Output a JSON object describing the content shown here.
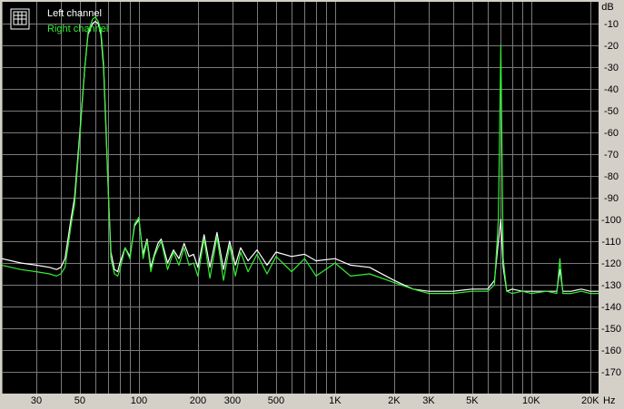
{
  "chart_data": {
    "type": "line",
    "xscale": "log",
    "xlim": [
      20,
      22050
    ],
    "ylim": [
      -180,
      0
    ],
    "grid": true,
    "y_unit": "dB",
    "x_unit": "Hz",
    "legend_placement": "top-left",
    "x_tick_labels": [
      {
        "label": "30",
        "value": 30
      },
      {
        "label": "50",
        "value": 50
      },
      {
        "label": "100",
        "value": 100
      },
      {
        "label": "200",
        "value": 200
      },
      {
        "label": "300",
        "value": 300
      },
      {
        "label": "500",
        "value": 500
      },
      {
        "label": "1K",
        "value": 1000
      },
      {
        "label": "2K",
        "value": 2000
      },
      {
        "label": "3K",
        "value": 3000
      },
      {
        "label": "5K",
        "value": 5000
      },
      {
        "label": "10K",
        "value": 10000
      },
      {
        "label": "20K",
        "value": 20000
      }
    ],
    "y_ticks": [
      -10,
      -20,
      -30,
      -40,
      -50,
      -60,
      -70,
      -80,
      -90,
      -100,
      -110,
      -120,
      -130,
      -140,
      -150,
      -160,
      -170
    ],
    "series": [
      {
        "name": "Left channel",
        "color": "#ffffff",
        "x": [
          20,
          25,
          30,
          35,
          38,
          40,
          42,
          45,
          47,
          50,
          53,
          55,
          58,
          60,
          62,
          64,
          66,
          68,
          70,
          72,
          75,
          78,
          80,
          85,
          90,
          95,
          100,
          105,
          110,
          115,
          120,
          125,
          130,
          140,
          150,
          160,
          170,
          180,
          190,
          200,
          215,
          230,
          250,
          270,
          290,
          310,
          330,
          360,
          400,
          450,
          500,
          600,
          700,
          800,
          1000,
          1200,
          1500,
          2000,
          2500,
          3000,
          4000,
          5000,
          6000,
          6500,
          6800,
          7000,
          7200,
          7500,
          8000,
          9000,
          10000,
          12000,
          13500,
          14000,
          14500,
          16000,
          18000,
          20000,
          22050
        ],
        "y": [
          -118,
          -120,
          -121,
          -122,
          -123,
          -122,
          -118,
          -100,
          -90,
          -60,
          -30,
          -15,
          -10,
          -9,
          -10,
          -15,
          -30,
          -60,
          -90,
          -115,
          -123,
          -124,
          -120,
          -113,
          -117,
          -103,
          -100,
          -116,
          -109,
          -122,
          -116,
          -111,
          -109,
          -120,
          -114,
          -118,
          -111,
          -117,
          -116,
          -122,
          -107,
          -122,
          -106,
          -123,
          -110,
          -121,
          -113,
          -119,
          -114,
          -121,
          -115,
          -117,
          -116,
          -119,
          -118,
          -121,
          -122,
          -128,
          -132,
          -133,
          -133,
          -132,
          -132,
          -128,
          -110,
          -100,
          -122,
          -133,
          -132,
          -133,
          -133,
          -133,
          -133,
          -123,
          -133,
          -133,
          -132,
          -133,
          -133
        ]
      },
      {
        "name": "Right channel",
        "color": "#33ee33",
        "x": [
          20,
          25,
          30,
          35,
          38,
          40,
          42,
          45,
          47,
          50,
          53,
          55,
          58,
          60,
          62,
          64,
          66,
          68,
          70,
          72,
          75,
          78,
          80,
          85,
          90,
          95,
          100,
          105,
          110,
          115,
          120,
          125,
          130,
          140,
          150,
          160,
          170,
          180,
          190,
          200,
          215,
          230,
          250,
          270,
          290,
          310,
          330,
          360,
          400,
          450,
          500,
          600,
          700,
          800,
          1000,
          1200,
          1500,
          2000,
          2500,
          3000,
          4000,
          5000,
          6000,
          6500,
          6800,
          7000,
          7200,
          7500,
          8000,
          9000,
          10000,
          12000,
          13500,
          14000,
          14500,
          16000,
          18000,
          20000,
          22050
        ],
        "y": [
          -121,
          -123,
          -124,
          -125,
          -126,
          -125,
          -122,
          -103,
          -93,
          -62,
          -30,
          -14,
          -8,
          -7,
          -9,
          -13,
          -28,
          -58,
          -90,
          -118,
          -125,
          -126,
          -123,
          -113,
          -118,
          -102,
          -99,
          -118,
          -110,
          -124,
          -117,
          -113,
          -110,
          -123,
          -115,
          -121,
          -113,
          -121,
          -120,
          -126,
          -109,
          -127,
          -108,
          -128,
          -112,
          -126,
          -115,
          -124,
          -116,
          -125,
          -117,
          -124,
          -118,
          -126,
          -120,
          -126,
          -125,
          -129,
          -132,
          -134,
          -134,
          -133,
          -133,
          -130,
          -100,
          -20,
          -118,
          -133,
          -134,
          -133,
          -134,
          -133,
          -134,
          -118,
          -134,
          -134,
          -133,
          -134,
          -134
        ]
      }
    ]
  }
}
